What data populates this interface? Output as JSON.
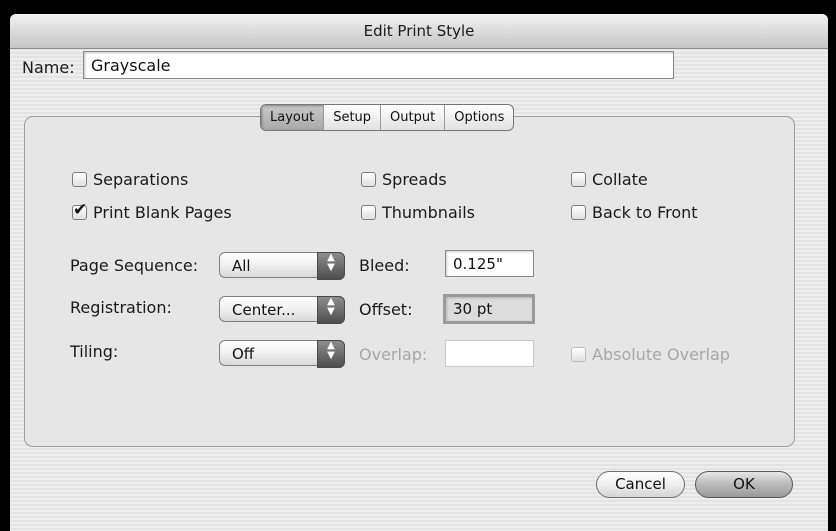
{
  "window": {
    "title": "Edit Print Style"
  },
  "name_field": {
    "label": "Name:",
    "value": "Grayscale"
  },
  "tabs": [
    {
      "label": "Layout",
      "active": true
    },
    {
      "label": "Setup",
      "active": false
    },
    {
      "label": "Output",
      "active": false
    },
    {
      "label": "Options",
      "active": false
    }
  ],
  "checkboxes": {
    "separations": {
      "label": "Separations",
      "checked": false
    },
    "spreads": {
      "label": "Spreads",
      "checked": false
    },
    "collate": {
      "label": "Collate",
      "checked": false
    },
    "print_blank_pages": {
      "label": "Print Blank Pages",
      "checked": true
    },
    "thumbnails": {
      "label": "Thumbnails",
      "checked": false
    },
    "back_to_front": {
      "label": "Back to Front",
      "checked": false
    },
    "absolute_overlap": {
      "label": "Absolute Overlap",
      "checked": false,
      "enabled": false
    }
  },
  "popups": {
    "page_sequence": {
      "label": "Page Sequence:",
      "value": "All"
    },
    "registration": {
      "label": "Registration:",
      "value": "Center..."
    },
    "tiling": {
      "label": "Tiling:",
      "value": "Off"
    }
  },
  "fields": {
    "bleed": {
      "label": "Bleed:",
      "value": "0.125\""
    },
    "offset": {
      "label": "Offset:",
      "value": "30 pt"
    },
    "overlap": {
      "label": "Overlap:",
      "value": "",
      "enabled": false
    }
  },
  "buttons": {
    "cancel": "Cancel",
    "ok": "OK"
  },
  "icons": {
    "check": "checkmark-icon",
    "popup_arrows": "up-down-arrows-icon"
  },
  "colors": {
    "background": "#e6e6e6",
    "disabled_text": "#a6a6a6"
  }
}
